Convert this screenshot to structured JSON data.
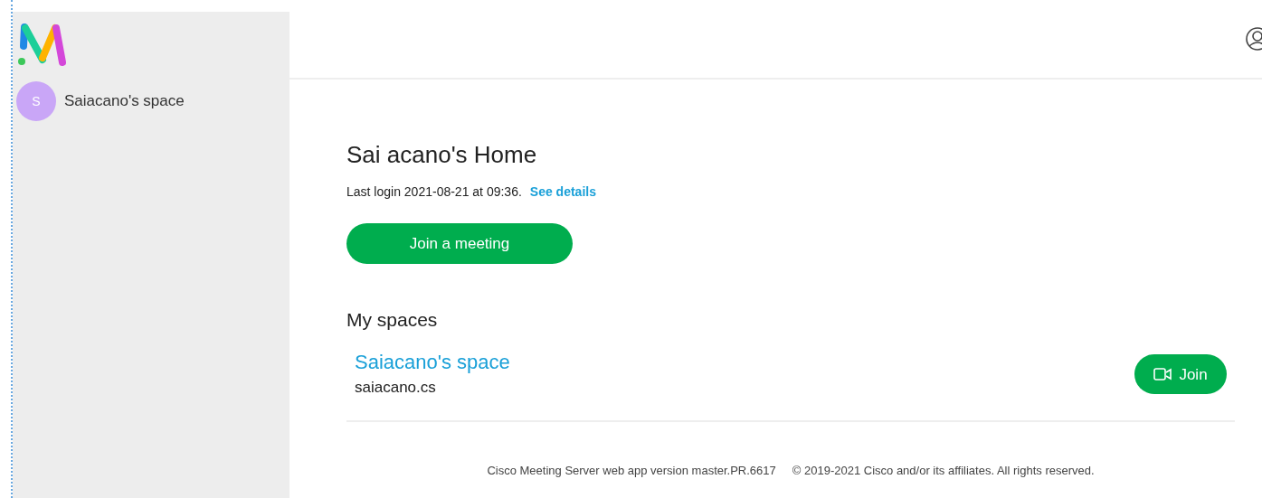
{
  "sidebar": {
    "spaces": [
      {
        "avatar": "S",
        "name": "Saiacano's space",
        "selected": false
      }
    ]
  },
  "home": {
    "title": "Sai acano's Home",
    "last_login": "Last login 2021-08-21 at 09:36.",
    "details_link": "See details",
    "join_meeting_button": "Join a meeting"
  },
  "my_spaces": {
    "heading": "My spaces",
    "items": [
      {
        "name": "Saiacano's space",
        "uri": "saiacano.cs",
        "join_button": "Join"
      }
    ]
  },
  "footer": {
    "version": "Cisco Meeting Server web app version master.PR.6617",
    "copyright": "© 2019-2021 Cisco and/or its affiliates. All rights reserved."
  }
}
